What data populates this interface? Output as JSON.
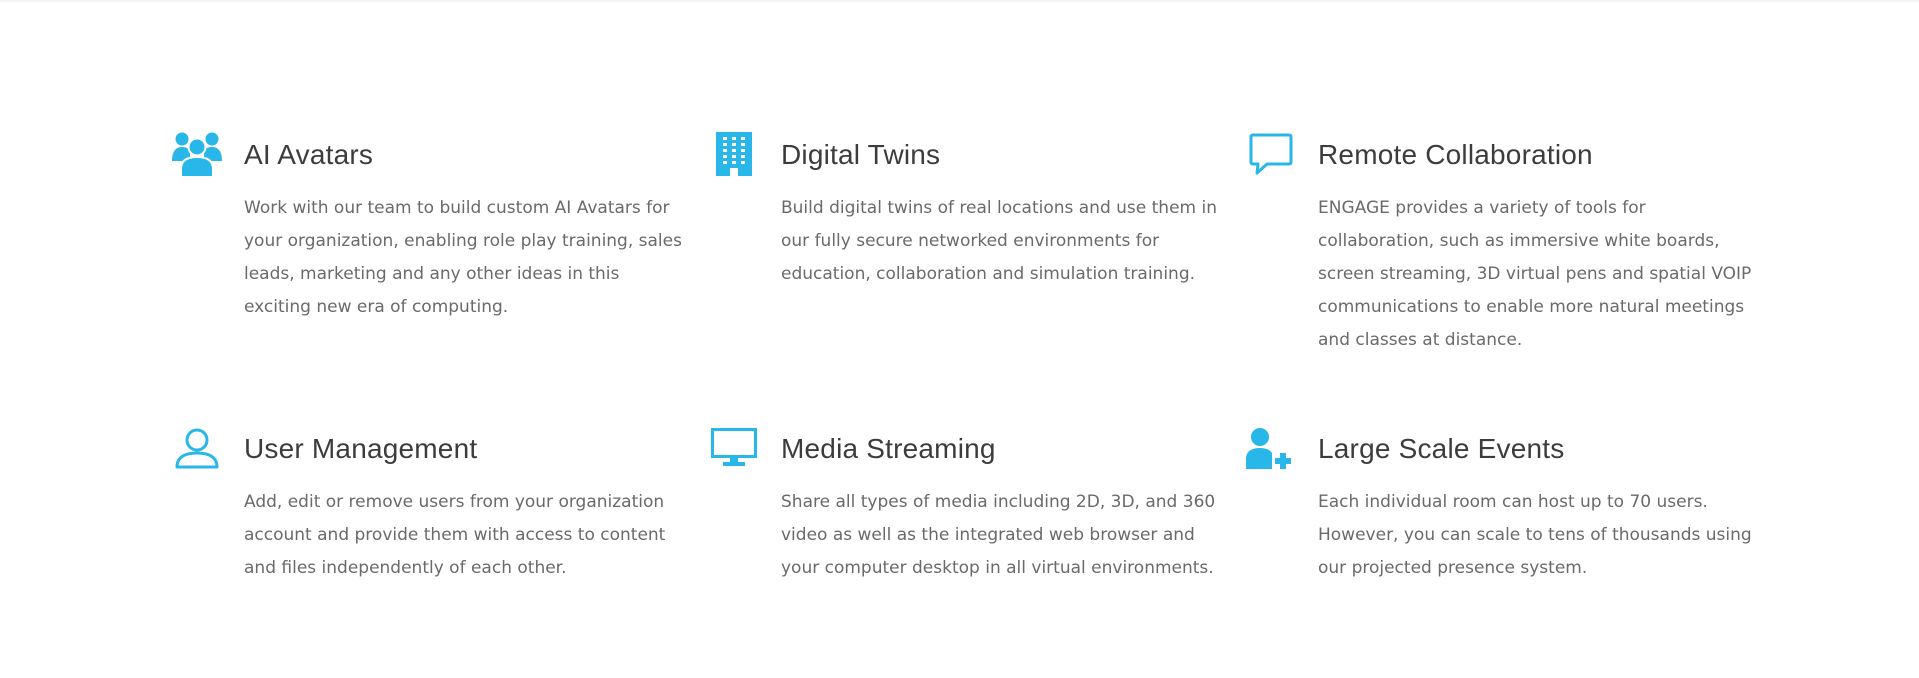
{
  "colors": {
    "accent": "#29b6e8",
    "title": "#3c3c3c",
    "text": "#6a6a6a"
  },
  "features": [
    {
      "icon": "users-group-icon",
      "title": "AI Avatars",
      "text": "Work with our team to build custom AI Avatars for your organization, enabling role play training, sales leads, marketing and any other ideas in this exciting new era of computing."
    },
    {
      "icon": "building-icon",
      "title": "Digital Twins",
      "text": "Build digital twins of real locations and use them in our fully secure networked environments for education, collaboration and simulation training."
    },
    {
      "icon": "chat-bubble-icon",
      "title": "Remote Collaboration",
      "text": "ENGAGE provides a variety of tools for collaboration, such as immersive white boards, screen streaming, 3D virtual pens and spatial VOIP communications to enable more natural meetings and classes at distance."
    },
    {
      "icon": "user-outline-icon",
      "title": "User Management",
      "text": "Add, edit or remove users from your organization account and provide them with access to content and files independently of each other."
    },
    {
      "icon": "monitor-icon",
      "title": "Media Streaming",
      "text": "Share all types of media including 2D, 3D, and 360 video as well as the integrated web browser and your computer desktop in all virtual environments."
    },
    {
      "icon": "user-plus-icon",
      "title": "Large Scale Events",
      "text": "Each individual room can host up to 70 users. However, you can scale to tens of thousands using our projected presence system."
    }
  ]
}
